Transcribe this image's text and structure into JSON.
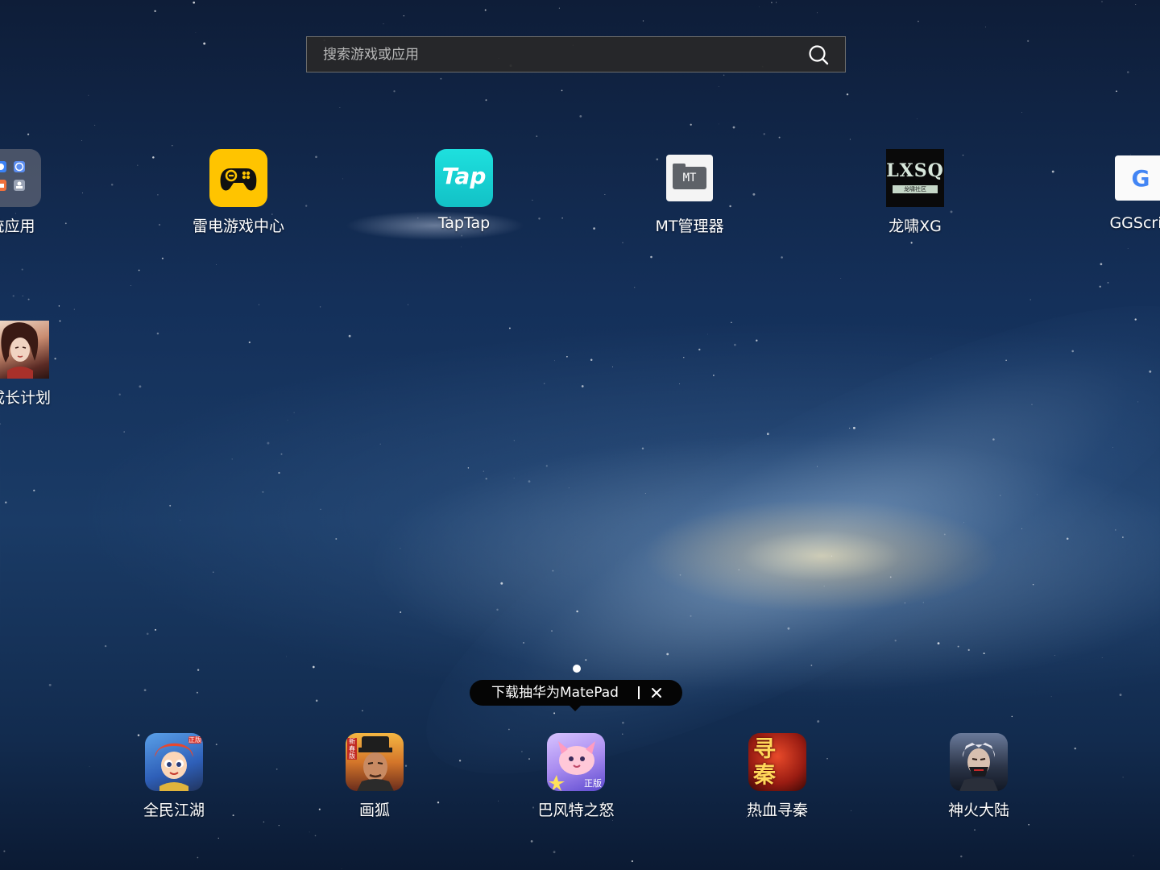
{
  "search": {
    "placeholder": "搜索游戏或应用",
    "icon": "search-icon"
  },
  "desktop": {
    "row1": [
      {
        "label": "统应用",
        "icon": "system-apps-folder-icon"
      },
      {
        "label": "雷电游戏中心",
        "icon": "gamepad-icon",
        "color": "#ffc400"
      },
      {
        "label": "TapTap",
        "icon": "taptap-icon",
        "icon_text": "Tap",
        "color": "#14d0d0"
      },
      {
        "label": "MT管理器",
        "icon": "mt-manager-icon",
        "icon_text": "MT"
      },
      {
        "label": "龙啸XG",
        "icon": "lxsq-icon",
        "icon_text": "LXSQ",
        "icon_subtext": "龙啸社区"
      },
      {
        "label": "GGScrip",
        "icon": "ggscript-icon",
        "icon_text": "G"
      }
    ],
    "row2": [
      {
        "label": "成长计划",
        "icon": "growth-plan-icon"
      }
    ]
  },
  "pager": {
    "current": 1,
    "total": 1
  },
  "promo": {
    "text": "下载抽华为MatePad",
    "close_icon": "close-icon"
  },
  "dock": [
    {
      "label": "全民江湖",
      "icon": "quanmin-jianghu-icon",
      "badge": "正版"
    },
    {
      "label": "画狐",
      "icon": "huahu-icon",
      "badge": "新春版"
    },
    {
      "label": "巴风特之怒",
      "icon": "bafengte-icon",
      "badge": "正版"
    },
    {
      "label": "热血寻秦",
      "icon": "rexue-xunqin-icon",
      "icon_text": "寻秦"
    },
    {
      "label": "神火大陆",
      "icon": "shenhuo-dalu-icon"
    }
  ]
}
